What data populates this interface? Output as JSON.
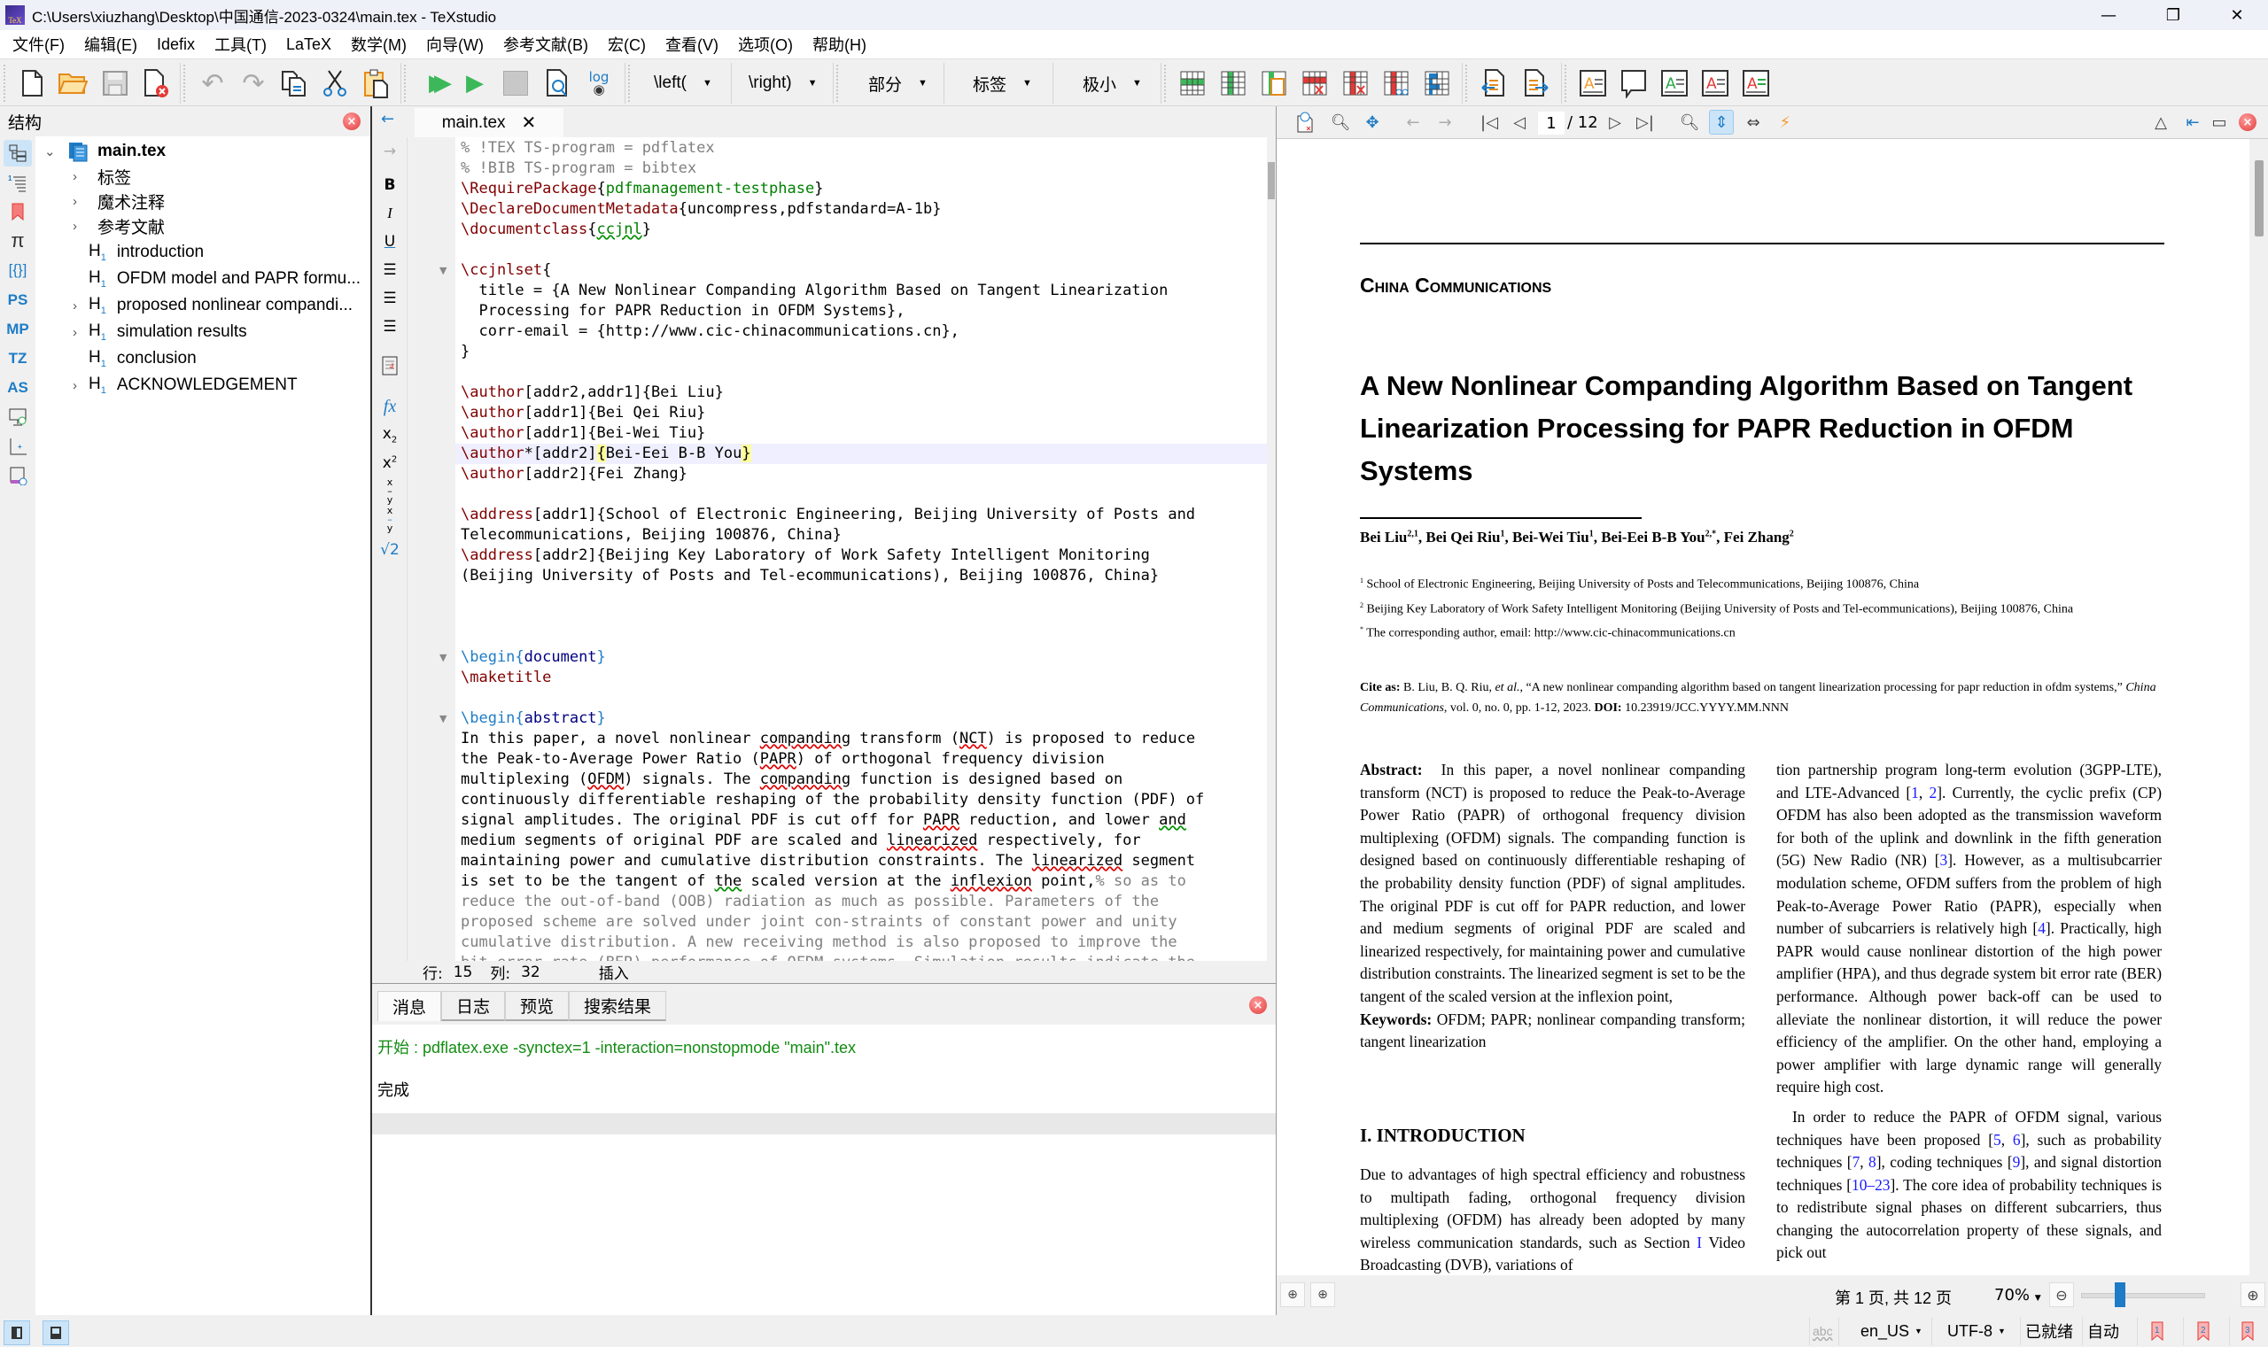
{
  "window": {
    "title": "C:\\Users\\xiuzhang\\Desktop\\中国通信-2023-0324\\main.tex - TeXstudio",
    "app_icon": "texstudio-icon",
    "controls": [
      "minimize",
      "restore",
      "close"
    ]
  },
  "menu": [
    "文件(F)",
    "编辑(E)",
    "Idefix",
    "工具(T)",
    "LaTeX",
    "数学(M)",
    "向导(W)",
    "参考文献(B)",
    "宏(C)",
    "查看(V)",
    "选项(O)",
    "帮助(H)"
  ],
  "toolbar": {
    "file_icons": [
      "new-file-icon",
      "open-folder-icon",
      "save-icon",
      "close-file-icon"
    ],
    "edit_icons": [
      "undo-icon",
      "redo-icon",
      "copy-icon",
      "cut-icon",
      "paste-icon"
    ],
    "build_icons": [
      "build-view-icon",
      "compile-icon",
      "stop-icon",
      "view-pdf-icon",
      "view-log-icon"
    ],
    "dropdowns": [
      {
        "label": "\\left(",
        "icon": "dropdown-arrow-icon"
      },
      {
        "label": "\\right)",
        "icon": "dropdown-arrow-icon"
      },
      {
        "label": "部分",
        "icon": "dropdown-arrow-icon"
      },
      {
        "label": "标签",
        "icon": "dropdown-arrow-icon"
      },
      {
        "label": "极小",
        "icon": "dropdown-arrow-icon"
      }
    ],
    "table_icons": [
      "add-row-icon",
      "add-column-icon",
      "paste-column-icon",
      "remove-row-icon",
      "remove-column-icon",
      "cut-column-icon",
      "align-column-icon"
    ],
    "log_icons": "◀▶",
    "annotation_colors": [
      "#f39c32",
      "#333333",
      "#2aa84a",
      "#e53935",
      "#2aa84a"
    ]
  },
  "structure": {
    "title": "结构",
    "root": "main.tex",
    "items": [
      {
        "label": "标签",
        "heading": false,
        "expandable": true
      },
      {
        "label": "魔术注释",
        "heading": false,
        "expandable": true
      },
      {
        "label": "参考文献",
        "heading": false,
        "expandable": true
      },
      {
        "label": "introduction",
        "heading": true,
        "expandable": false
      },
      {
        "label": "OFDM model and PAPR formu...",
        "heading": true,
        "expandable": false
      },
      {
        "label": "proposed nonlinear compandi...",
        "heading": true,
        "expandable": true
      },
      {
        "label": "simulation results",
        "heading": true,
        "expandable": true
      },
      {
        "label": "conclusion",
        "heading": true,
        "expandable": false
      },
      {
        "label": "ACKNOWLEDGEMENT",
        "heading": true,
        "expandable": true
      }
    ],
    "rail": [
      "structure-icon",
      "toc-icon",
      "bookmark-icon",
      "symbols-pi-icon",
      "braces-icon",
      "PS",
      "MP",
      "TZ",
      "AS",
      "presentation-icon",
      "axis-icon",
      "script-icon"
    ]
  },
  "editor": {
    "tab": "main.tex",
    "format_rail": [
      "←",
      "→",
      "B",
      "I",
      "U",
      "≡",
      "≡",
      "≡",
      "⎙",
      "fx",
      "x₂",
      "x²",
      "x/y",
      "x/y",
      "√2"
    ],
    "lines": [
      {
        "html": "<span class='cm'>% !TEX TS-program = pdflatex</span>"
      },
      {
        "html": "<span class='cm'>% !BIB TS-program = bibtex</span>"
      },
      {
        "html": "<span class='kw'>\\RequirePackage</span>{<span class='arg'>pdfmanagement-testphase</span>}"
      },
      {
        "html": "<span class='kw'>\\DeclareDocumentMetadata</span>{uncompress,pdfstandard=A-1b}"
      },
      {
        "html": "<span class='kw'>\\documentclass</span>{<span class='arg sqg'>ccjnl</span>}"
      },
      {
        "html": ""
      },
      {
        "html": "<span class='kw'>\\ccjnlset</span>{",
        "fold": true
      },
      {
        "html": "  title = {A New Nonlinear Companding Algorithm Based on Tangent Linearization"
      },
      {
        "html": "  Processing for PAPR Reduction in OFDM Systems},"
      },
      {
        "html": "  corr-email = {http://www.cic-chinacommunications.cn},"
      },
      {
        "html": "}"
      },
      {
        "html": ""
      },
      {
        "html": "<span class='kw'>\\author</span>[addr2,addr1]{Bei Liu}"
      },
      {
        "html": "<span class='kw'>\\author</span>[addr1]{Bei Qei Riu}"
      },
      {
        "html": "<span class='kw'>\\author</span>[addr1]{Bei-Wei Tiu}"
      },
      {
        "html": "<span class='kw'>\\author</span>*[addr2]<span class='brm'>{</span>Bei-Eei B-B You<span class='brm'>}</span>",
        "current": true
      },
      {
        "html": "<span class='kw'>\\author</span>[addr2]{Fei Zhang}"
      },
      {
        "html": ""
      },
      {
        "html": "<span class='kw'>\\address</span>[addr1]{School of Electronic Engineering, Beijing University of Posts and"
      },
      {
        "html": "Telecommunications, Beijing 100876, China}"
      },
      {
        "html": "<span class='kw'>\\address</span>[addr2]{Beijing Key Laboratory of Work Safety Intelligent Monitoring"
      },
      {
        "html": "(Beijing University of Posts and Tel-ecommunications), Beijing 100876, China}"
      },
      {
        "html": ""
      },
      {
        "html": ""
      },
      {
        "html": ""
      },
      {
        "html": "<span class='env'>\\begin{</span><span class='envn'>document</span><span class='env'>}</span>",
        "fold": true
      },
      {
        "html": "<span class='kw'>\\maketitle</span>"
      },
      {
        "html": ""
      },
      {
        "html": "<span class='env'>\\begin{</span><span class='envn'>abstract</span><span class='env'>}</span>",
        "fold": true
      },
      {
        "html": "In this paper, a novel nonlinear <span class='sq'>companding</span> transform (<span class='sq'>NCT</span>) is proposed to reduce"
      },
      {
        "html": "the Peak-to-Average Power Ratio (<span class='sq'>PAPR</span>) of orthogonal frequency division"
      },
      {
        "html": "multiplexing (<span class='sq'>OFDM</span>) signals. The <span class='sq'>companding</span> function is designed based on"
      },
      {
        "html": "continuously differentiable reshaping of the probability density function (PDF) of"
      },
      {
        "html": "signal amplitudes. The original PDF is cut off for <span class='sq'>PAPR</span> reduction, and lower <span class='sqg'>and</span>"
      },
      {
        "html": "medium segments of original PDF are scaled and <span class='sq'>linearized</span> respectively, for"
      },
      {
        "html": "maintaining power and cumulative distribution constraints. The <span class='sq'>linearized</span> segment"
      },
      {
        "html": "is set to be the tangent of <span class='sqg'>the</span> scaled version at the <span class='sq'>inflexion</span> point,<span class='cm'>% so as to</span>"
      },
      {
        "html": "<span class='cm'>reduce the out-of-band (OOB) radiation as much as possible. Parameters of the</span>"
      },
      {
        "html": "<span class='cm'>proposed scheme are solved under joint con-straints of constant power and unity</span>"
      },
      {
        "html": "<span class='cm'>cumulative distribution. A new receiving method is also proposed to improve the</span>"
      },
      {
        "html": "<span class='cm'>bit error rate (BER) performance of OFDM systems. Simulation results indicate the</span>"
      }
    ],
    "status": {
      "line_label": "行:",
      "line": "15",
      "col_label": "列:",
      "col": "32",
      "mode": "插入"
    }
  },
  "messages": {
    "tabs": [
      "消息",
      "日志",
      "预览",
      "搜索结果"
    ],
    "active_tab": 0,
    "lines": [
      "开始 : pdflatex.exe -synctex=1 -interaction=nonstopmode \"main\".tex",
      "完成"
    ]
  },
  "pdf": {
    "page_current": "1",
    "page_total": "/ 12",
    "header_rule": true,
    "journal": "China Communications",
    "title": "A New Nonlinear Companding Algorithm Based on Tangent Linearization Processing for PAPR Reduction in OFDM Systems",
    "authors": [
      {
        "name": "Bei Liu",
        "sup": "2,1"
      },
      {
        "name": "Bei Qei Riu",
        "sup": "1"
      },
      {
        "name": "Bei-Wei Tiu",
        "sup": "1"
      },
      {
        "name": "Bei-Eei B-B You",
        "sup": "2,*"
      },
      {
        "name": "Fei Zhang",
        "sup": "2"
      }
    ],
    "affiliations": [
      {
        "mark": "1",
        "text": "School of Electronic Engineering, Beijing University of Posts and Telecommunications, Beijing 100876, China"
      },
      {
        "mark": "2",
        "text": "Beijing Key Laboratory of Work Safety Intelligent Monitoring (Beijing University of Posts and Tel-ecommunications), Beijing 100876, China"
      },
      {
        "mark": "*",
        "text": "The corresponding author, email: http://www.cic-chinacommunications.cn"
      }
    ],
    "cite": {
      "label": "Cite as:",
      "text1": " B. Liu, B. Q. Riu, ",
      "etal": "et al.",
      "text2": ", “A new nonlinear companding algorithm based on tangent linearization processing for papr reduction in ofdm systems,” ",
      "journal": "China Communications",
      "text3": ", vol. 0, no. 0, pp. 1-12, 2023. ",
      "doi_label": "DOI:",
      "doi": " 10.23919/JCC.YYYY.MM.NNN"
    },
    "abstract_label": "Abstract:",
    "abstract": "In this paper, a novel nonlinear companding transform (NCT) is proposed to reduce the Peak-to-Average Power Ratio (PAPR) of orthogonal frequency division multiplexing (OFDM) signals. The companding function is designed based on continuously differentiable reshaping of the probability density function (PDF) of signal amplitudes. The original PDF is cut off for PAPR reduction, and lower and medium segments of original PDF are scaled and linearized respectively, for maintaining power and cumulative distribution constraints. The linearized segment is set to be the tangent of the scaled version at the inflexion point,",
    "keywords_label": "Keywords:",
    "keywords": "OFDM; PAPR; nonlinear companding transform; tangent linearization",
    "section1": "I. INTRODUCTION",
    "intro_left": "Due to advantages of high spectral efficiency and robustness to multipath fading, orthogonal frequency division multiplexing (OFDM) has already been adopted by many wireless communication standards, such as Section <span class='blue'>I</span> Video Broadcasting (DVB), variations of",
    "right_col_p1": "tion partnership program long-term evolution (3GPP-LTE), and LTE-Advanced [<span class='blue'>1</span>, <span class='blue'>2</span>]. Currently, the cyclic prefix (CP) OFDM has also been adopted as the transmission waveform for both of the uplink and downlink in the fifth generation (5G) New Radio (NR) [<span class='blue'>3</span>]. However, as a multisubcarrier modulation scheme, OFDM suffers from the problem of high Peak-to-Average Power Ratio (PAPR), especially when number of subcarriers is relatively high [<span class='blue'>4</span>]. Practically, high PAPR would cause nonlinear distortion of the high power amplifier (HPA), and thus degrade system bit error rate (BER) performance. Although power back-off can be used to alleviate the nonlinear distortion, it will reduce the power efficiency of the amplifier. On the other hand, employing a power amplifier with large dynamic range will generally require high cost.",
    "right_col_p2": "In order to reduce the PAPR of OFDM signal, various techniques have been proposed [<span class='blue'>5</span>, <span class='blue'>6</span>], such as probability techniques [<span class='blue'>7</span>, <span class='blue'>8</span>], coding techniques [<span class='blue'>9</span>], and signal distortion techniques [<span class='blue'>10–23</span>]. The core idea of probability techniques is to redistribute signal phases on different subcarriers, thus changing the autocorrelation property of these signals, and pick out",
    "page_info": "第 1 页, 共 12 页",
    "zoom": "70%",
    "zoom_slider_fraction": 0.27
  },
  "statusbar": {
    "left_icons": [
      "toggle-structure-icon",
      "toggle-messages-icon"
    ],
    "spell_icon": "abc",
    "language": "en_US",
    "encoding": "UTF-8",
    "state": "已就绪",
    "mode": "自动",
    "bookmarks": [
      "1",
      "2",
      "3"
    ]
  }
}
